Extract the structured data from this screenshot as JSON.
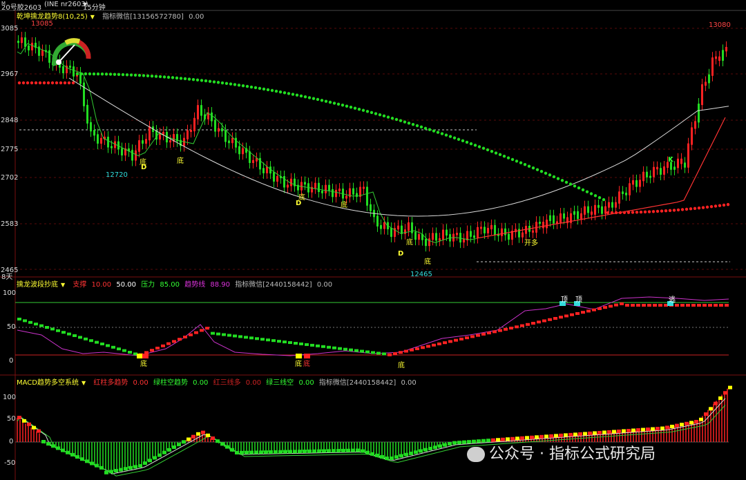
{
  "topbar": {
    "symbol": "20号胶2603",
    "symbol_sup": "M",
    "exchange_code": "(INE nr2603)",
    "period": "15分钟",
    "period_arrow": "▼"
  },
  "main_panel": {
    "indicator_name": "乾坤擒龙趋势8(10,25)",
    "indicator_arrow": "▼",
    "wechat_label": "指标微信[13156572780]",
    "value": "0.00",
    "y_ticks": [
      "3085",
      "2967",
      "2848",
      "2775",
      "2702",
      "2583",
      "2465"
    ],
    "bottom_label": "8天",
    "high_left": "13085",
    "high_right": "13080",
    "low_left": "12720",
    "low_bottom": "12465",
    "annotations": {
      "di": "底",
      "d": "D",
      "kai_duo": "开多",
      "k": "K"
    }
  },
  "wave_panel": {
    "title": "擒龙波段抄底",
    "title_arrow": "▼",
    "support_label": "支撑",
    "support_value": "10.00",
    "mid_value": "50.00",
    "pressure_label": "压力",
    "pressure_value": "85.00",
    "trend_label": "趋势线",
    "trend_value": "88.90",
    "wechat_label": "指标微信[2440158442]",
    "value": "0.00",
    "y_ticks": [
      "100",
      "50",
      "0"
    ],
    "marks": {
      "ding": "顶",
      "di": "底",
      "tao": "逃"
    }
  },
  "macd_panel": {
    "title": "MACD趋势多空系统",
    "title_arrow": "▼",
    "red_long_label": "红柱多趋势",
    "red_long_value": "0.00",
    "green_short_label": "绿柱空趋势",
    "green_short_value": "0.00",
    "red_three_label": "红三线多",
    "red_three_value": "0.00",
    "green_three_label": "绿三线空",
    "green_three_value": "0.00",
    "wechat_label": "指标微信[2440158442]",
    "value": "0.00",
    "y_ticks": [
      "100",
      "50",
      "0",
      "-50"
    ]
  },
  "watermark": {
    "text": "公众号 · 指标公式研究局"
  },
  "colors": {
    "up": "#ff2222",
    "down": "#22dd22",
    "yellow": "#ffff00",
    "cyan": "#33dddd",
    "magenta": "#cc33cc",
    "orange": "#ffa500"
  }
}
